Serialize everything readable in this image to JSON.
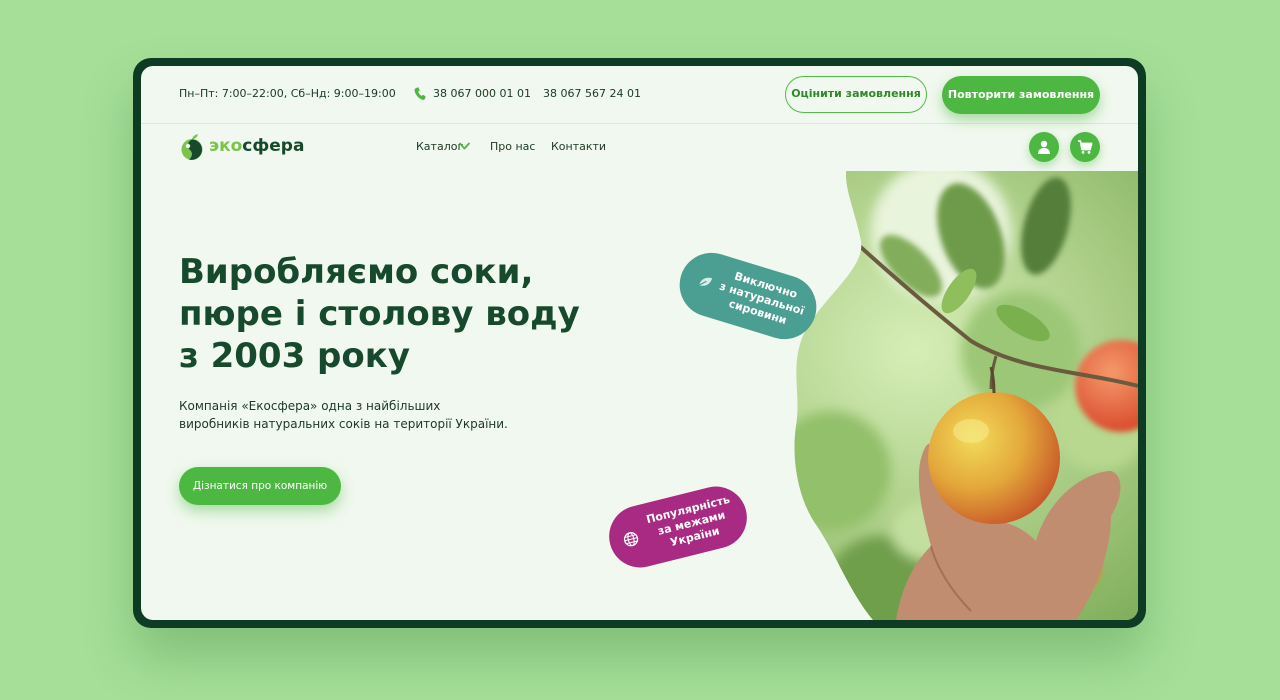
{
  "topbar": {
    "hours": "Пн–Пт: 7:00–22:00,  Сб–Нд: 9:00–19:00",
    "phone_1": "38 067 000 01 01",
    "phone_2": "38 067 567 24 01",
    "rate_order_label": "Оцінити замовлення",
    "repeat_order_label": "Повторити замовлення"
  },
  "brand": {
    "prefix": "эко",
    "suffix": "сфера"
  },
  "nav": {
    "catalog": "Каталог",
    "about": "Про нас",
    "contacts": "Контакти"
  },
  "hero": {
    "headline_line_1": "Виробляємо соки,",
    "headline_line_2": "пюре і столову воду",
    "headline_line_3": "з 2003 року",
    "description_line_1": "Компанія «Екосфера» одна з найбільших",
    "description_line_2": "виробників натуральних соків на території України.",
    "cta_label": "Дізнатися про компанію"
  },
  "badges": {
    "natural_line_1": "Виключно",
    "natural_line_2": "з натуральної",
    "natural_line_3": "сировини",
    "popular_line_1": "Популярність",
    "popular_line_2": "за межами",
    "popular_line_3": "України"
  },
  "icons": {
    "phone": "phone-icon",
    "user": "user-icon",
    "cart": "cart-icon",
    "leaf": "leaf-icon",
    "globe": "globe-icon",
    "chevron": "chevron-down-icon"
  },
  "colors": {
    "page_background": "#a6df98",
    "frame": "#0d3b24",
    "screen": "#f1f8ef",
    "brand_green": "#4cb842",
    "heading": "#174a2c",
    "badge_teal": "#4a9e92",
    "badge_magenta": "#a92a82"
  }
}
